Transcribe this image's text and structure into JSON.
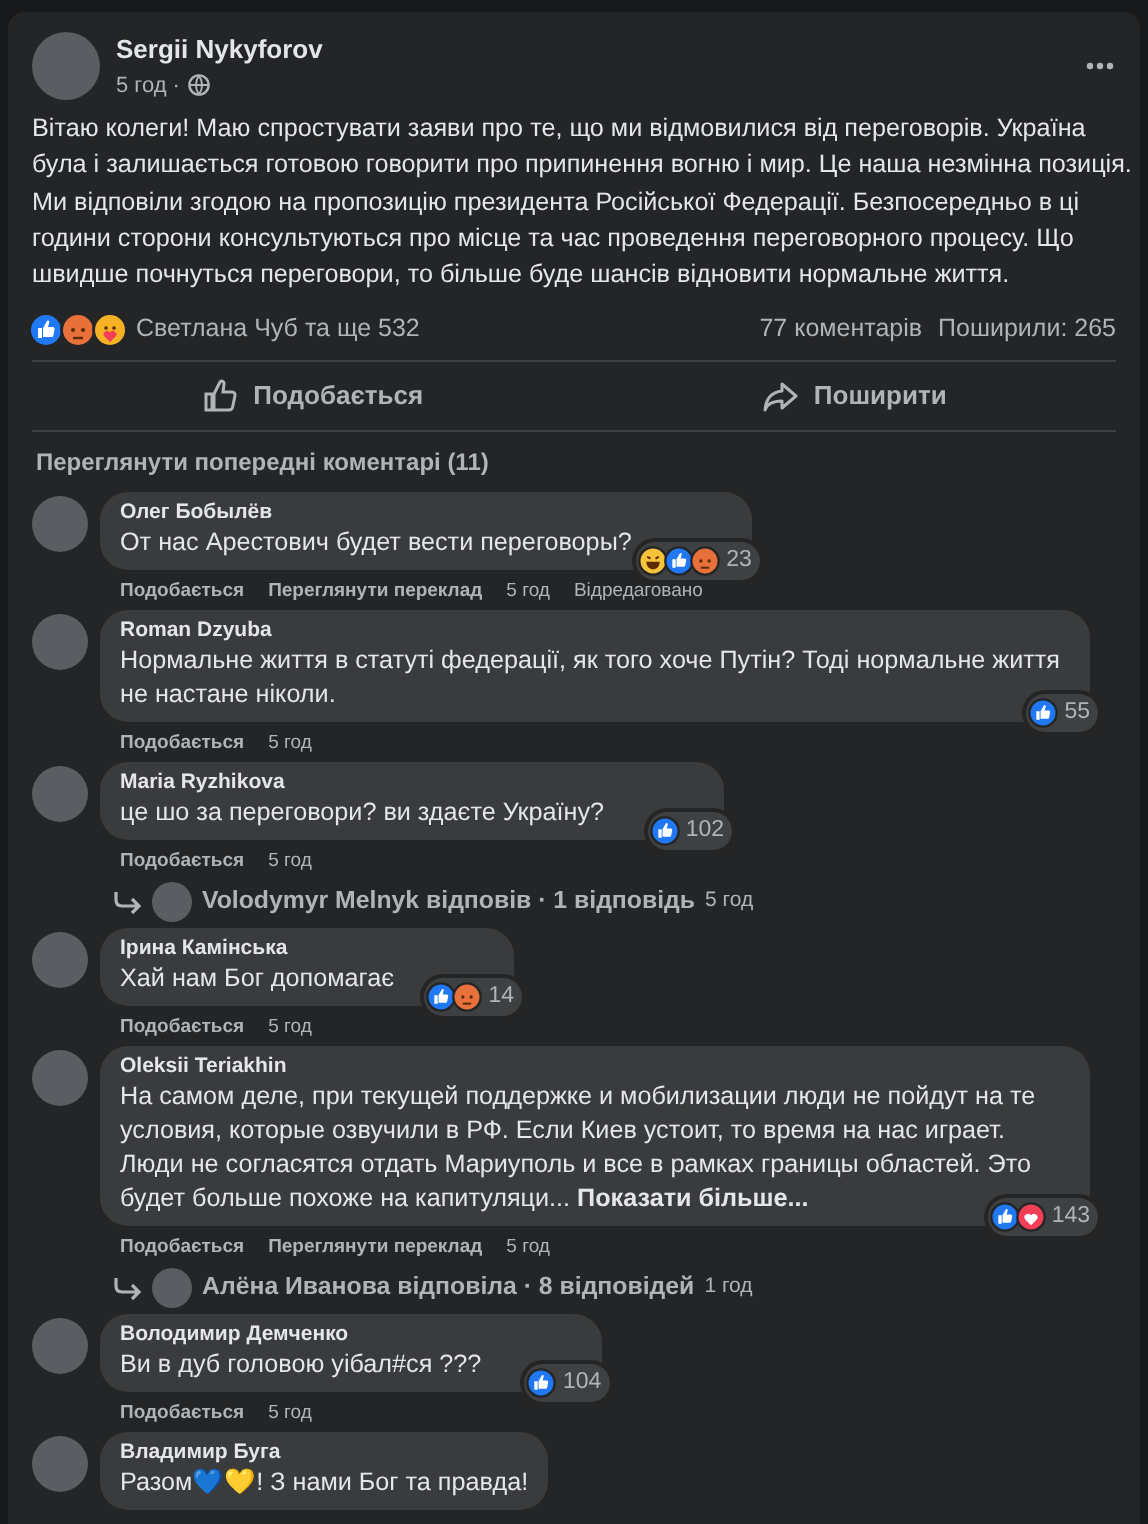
{
  "post": {
    "author": "Sergii Nykyforov",
    "time": "5 год ·",
    "text": "Вітаю колеги! Маю спростувати заяви про те, що ми відмовилися від переговорів. Україна була і залишається готовою говорити про припинення вогню і мир. Це наша незмінна позиція. Ми відповіли згодою на пропозицію президента Російської Федерації. Безпосередньо в ці години сторони консультуються про місце та час проведення переговорного процесу. Що швидше почнуться переговори, то більше буде шансів відновити нормальне життя.",
    "reactions": [
      {
        "kind": "like"
      },
      {
        "kind": "angry"
      },
      {
        "kind": "care"
      }
    ],
    "reactors": "Светлана Чуб та ще 532",
    "comments_count": "77 коментарів",
    "shares": "Поширили: 265",
    "actions": [
      {
        "kind": "like",
        "label": "Подобається"
      },
      {
        "kind": "share",
        "label": "Поширити"
      }
    ]
  },
  "previous_comments": "Переглянути попередні коментарі (11)",
  "comments": [
    {
      "name": "Олег Бобылёв",
      "text": "От нас Арестович будет вести переговоры?",
      "reactions": [
        {
          "kind": "haha"
        },
        {
          "kind": "like"
        },
        {
          "kind": "angry"
        }
      ],
      "count": "23",
      "like": "Подобається",
      "translate": "Переглянути переклад",
      "time": "5 год",
      "edited": "Відредаговано"
    },
    {
      "name": "Roman Dzyuba",
      "text": "Нормальне життя в статуті федерації, як того хоче Путін? Тоді нормальне життя не настане ніколи.",
      "reactions": [
        {
          "kind": "like"
        }
      ],
      "count": "55",
      "like": "Подобається",
      "time": "5 год"
    },
    {
      "name": "Maria Ryzhikova",
      "text": "це шо за переговори? ви здаєте Україну?",
      "reactions": [
        {
          "kind": "like"
        }
      ],
      "count": "102",
      "like": "Подобається",
      "time": "5 год",
      "reply": {
        "text": "Volodymyr Melnyk відповів · 1 відповідь",
        "time": "5 год"
      }
    },
    {
      "name": "Ірина Камінська",
      "text": "Хай нам Бог допомагає",
      "reactions": [
        {
          "kind": "like"
        },
        {
          "kind": "angry"
        }
      ],
      "count": "14",
      "like": "Подобається",
      "time": "5 год"
    },
    {
      "name": "Oleksii Teriakhin",
      "text": "На самом деле, при текущей поддержке и мобилизации люди не пойдут на те условия, которые озвучили в РФ. Если Киев устоит, то время на нас играет. Люди не согласятся отдать Мариуполь и все в рамках границы областей. Это будет больше похоже на капитуляци... **Показати більше...**",
      "reactions": [
        {
          "kind": "like"
        },
        {
          "kind": "love"
        }
      ],
      "count": "143",
      "like": "Подобається",
      "translate": "Переглянути переклад",
      "time": "5 год",
      "reply": {
        "text": "Алёна Иванова відповіла · 8 відповідей",
        "time": "1 год"
      }
    },
    {
      "name": "Володимир Демченко",
      "text": "Ви в дуб головою уібал#ся ???",
      "reactions": [
        {
          "kind": "like"
        }
      ],
      "count": "104",
      "like": "Подобається",
      "time": "5 год"
    },
    {
      "name": "Владимир Буга",
      "text": "Разом💙💛! З нами Бог та правда!"
    }
  ]
}
